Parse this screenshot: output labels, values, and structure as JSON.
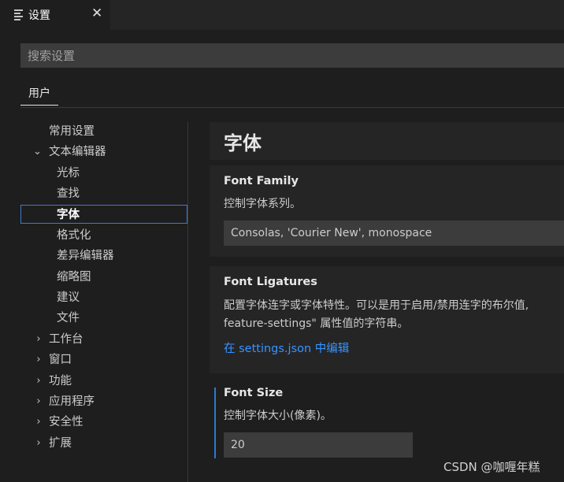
{
  "tab": {
    "title": "设置",
    "close": "✕"
  },
  "search": {
    "placeholder": "搜索设置",
    "value": ""
  },
  "scope_tabs": {
    "user": "用户"
  },
  "toc": {
    "items": [
      {
        "label": "常用设置",
        "chevron": ""
      },
      {
        "label": "文本编辑器",
        "chevron": "⌄"
      },
      {
        "label": "光标",
        "chevron": ""
      },
      {
        "label": "查找",
        "chevron": ""
      },
      {
        "label": "字体",
        "chevron": "",
        "selected": true
      },
      {
        "label": "格式化",
        "chevron": ""
      },
      {
        "label": "差异编辑器",
        "chevron": ""
      },
      {
        "label": "缩略图",
        "chevron": ""
      },
      {
        "label": "建议",
        "chevron": ""
      },
      {
        "label": "文件",
        "chevron": ""
      },
      {
        "label": "工作台",
        "chevron": "›"
      },
      {
        "label": "窗口",
        "chevron": "›"
      },
      {
        "label": "功能",
        "chevron": "›"
      },
      {
        "label": "应用程序",
        "chevron": "›"
      },
      {
        "label": "安全性",
        "chevron": "›"
      },
      {
        "label": "扩展",
        "chevron": "›"
      }
    ]
  },
  "content": {
    "group_title": "字体",
    "font_family": {
      "title": "Font Family",
      "description": "控制字体系列。",
      "value": "Consolas, 'Courier New', monospace"
    },
    "font_ligatures": {
      "title": "Font Ligatures",
      "description_line1": "配置字体连字或字体特性。可以是用于启用/禁用连字的布尔值,",
      "description_line2": "feature-settings\" 属性值的字符串。",
      "edit_link": "在 settings.json 中编辑"
    },
    "font_size": {
      "title": "Font Size",
      "description": "控制字体大小(像素)。",
      "value": "20"
    }
  },
  "watermark": "CSDN @咖喱年糕",
  "colors": {
    "background": "#1e1e1e",
    "panel": "#252526",
    "input": "#3c3c3c",
    "link": "#3794ff",
    "focus_border": "#3e7acb",
    "modified_bar": "#2a7bd0"
  }
}
